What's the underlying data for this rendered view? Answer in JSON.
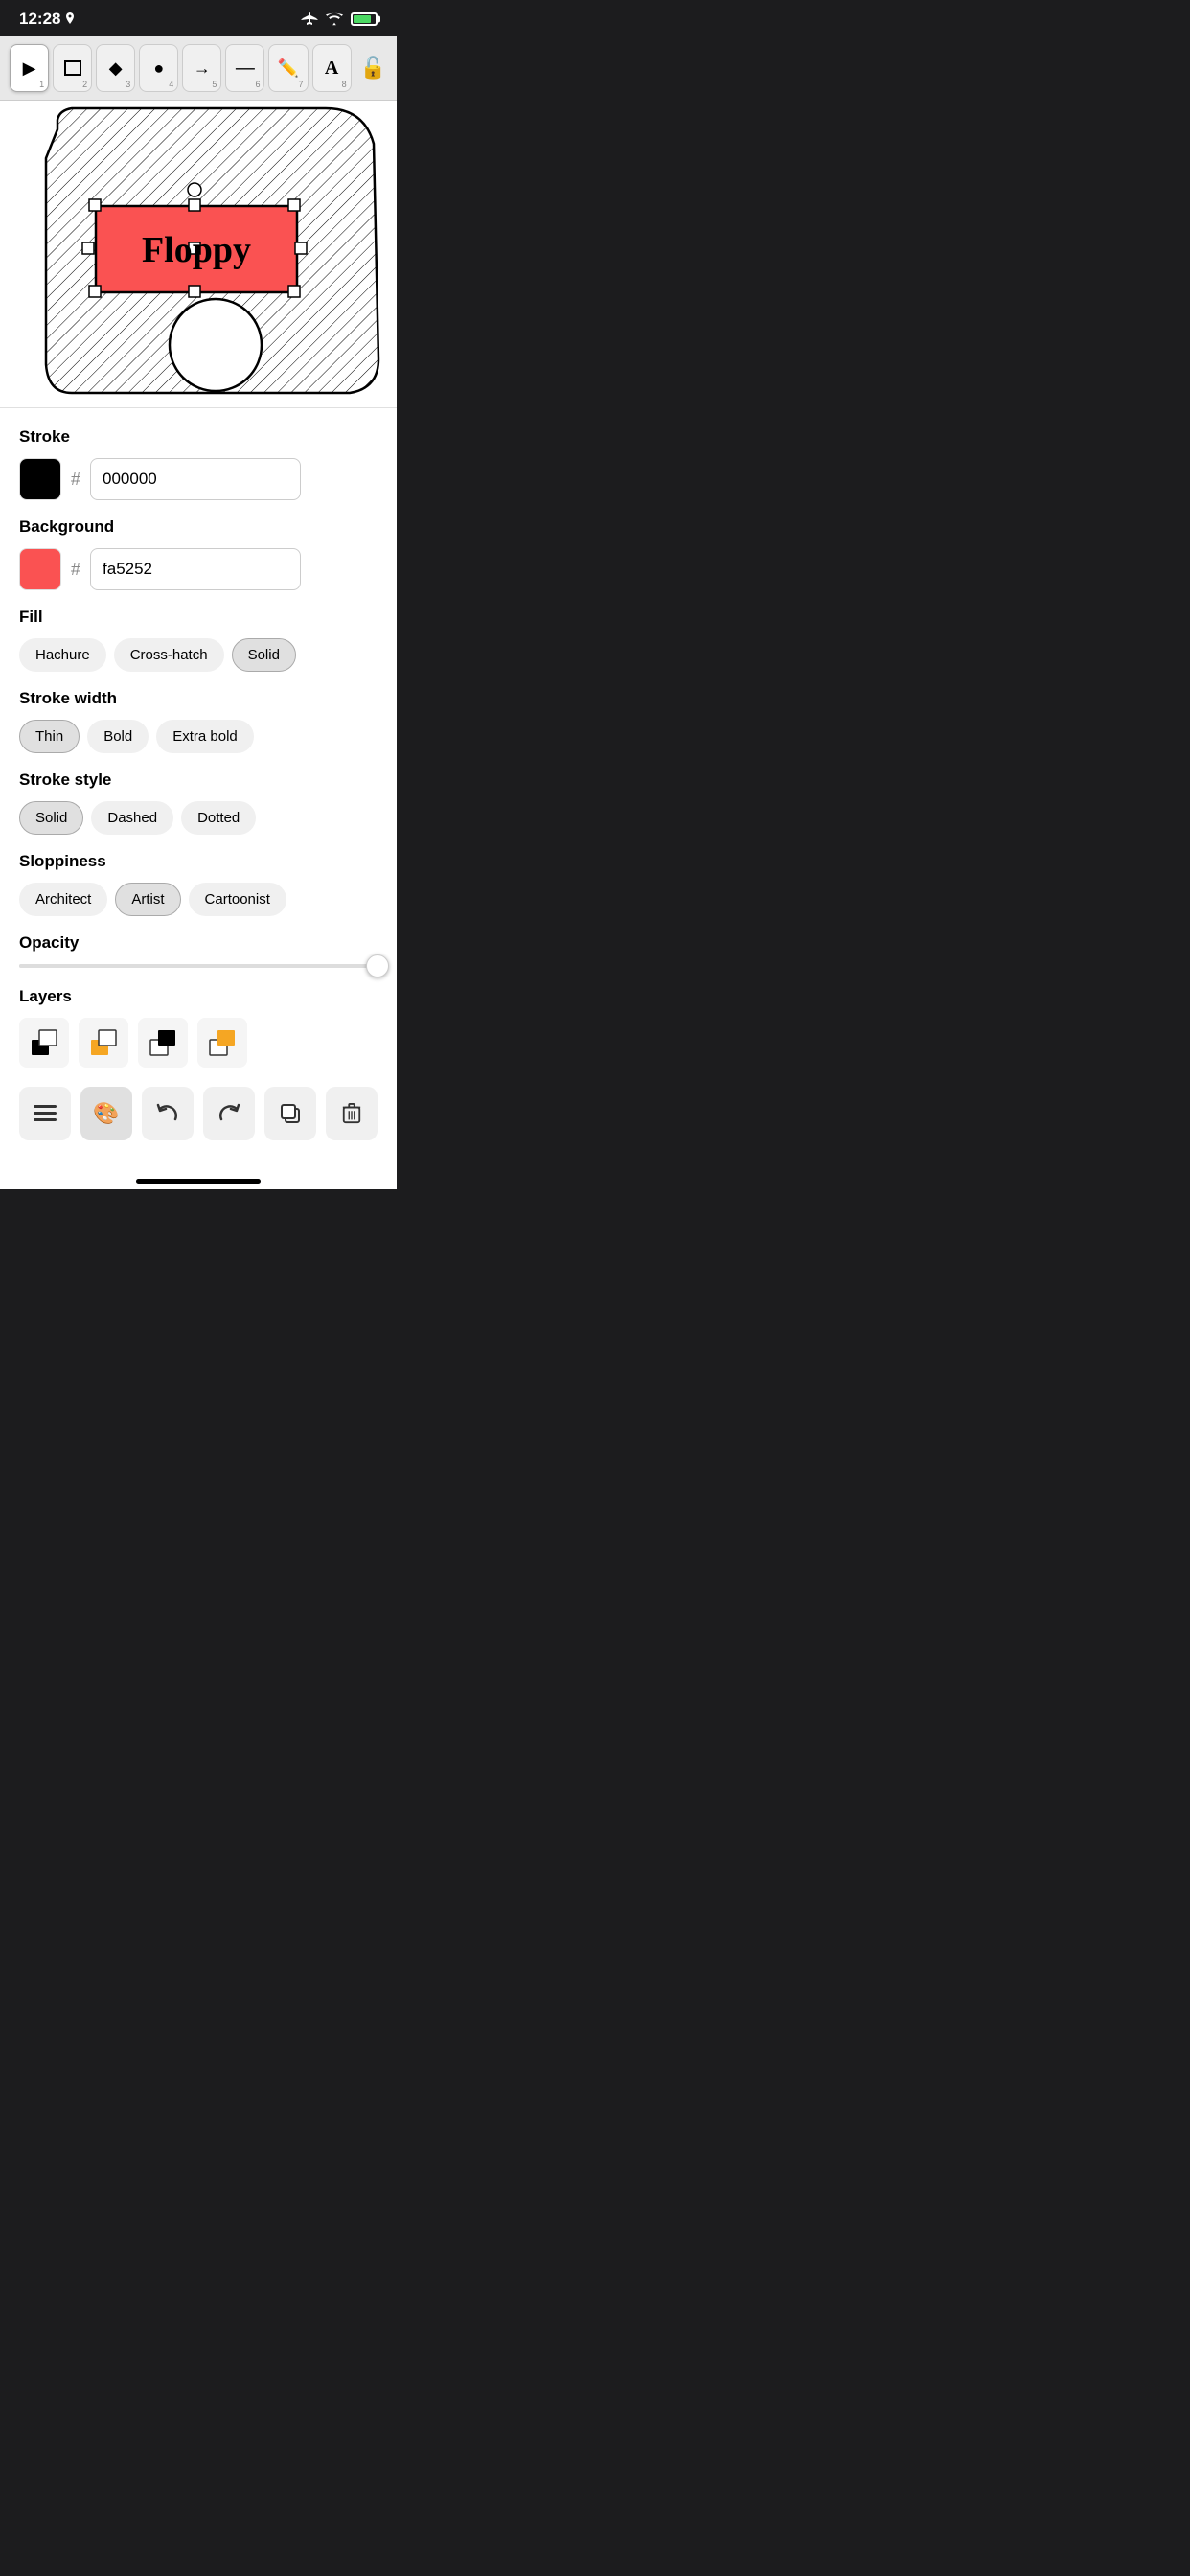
{
  "status": {
    "time": "12:28",
    "icons": [
      "location-icon",
      "airplane-icon",
      "wifi-icon",
      "battery-icon"
    ]
  },
  "toolbar": {
    "tools": [
      {
        "id": 1,
        "label": "cursor",
        "icon": "▶",
        "active": false
      },
      {
        "id": 2,
        "label": "rectangle",
        "icon": "■",
        "active": false
      },
      {
        "id": 3,
        "label": "diamond",
        "icon": "◆",
        "active": false
      },
      {
        "id": 4,
        "label": "circle",
        "icon": "●",
        "active": false
      },
      {
        "id": 5,
        "label": "arrow",
        "icon": "→",
        "active": false
      },
      {
        "id": 6,
        "label": "line",
        "icon": "—",
        "active": false
      },
      {
        "id": 7,
        "label": "pencil",
        "icon": "✏",
        "active": false
      },
      {
        "id": 8,
        "label": "text",
        "icon": "A",
        "active": false
      }
    ],
    "lock_icon": "🔓"
  },
  "canvas": {
    "description": "Floppy disk drawing with hatching pattern"
  },
  "properties": {
    "stroke_label": "Stroke",
    "stroke_color_hex": "000000",
    "stroke_swatch_color": "#000000",
    "background_label": "Background",
    "background_color_hex": "fa5252",
    "background_swatch_color": "#fa5252",
    "fill_label": "Fill",
    "fill_options": [
      {
        "label": "Hachure",
        "active": false
      },
      {
        "label": "Cross-hatch",
        "active": false
      },
      {
        "label": "Solid",
        "active": true
      }
    ],
    "stroke_width_label": "Stroke width",
    "stroke_width_options": [
      {
        "label": "Thin",
        "active": true
      },
      {
        "label": "Bold",
        "active": false
      },
      {
        "label": "Extra bold",
        "active": false
      }
    ],
    "stroke_style_label": "Stroke style",
    "stroke_style_options": [
      {
        "label": "Solid",
        "active": true
      },
      {
        "label": "Dashed",
        "active": false
      },
      {
        "label": "Dotted",
        "active": false
      }
    ],
    "sloppiness_label": "Sloppiness",
    "sloppiness_options": [
      {
        "label": "Architect",
        "active": false
      },
      {
        "label": "Artist",
        "active": true
      },
      {
        "label": "Cartoonist",
        "active": false
      }
    ],
    "opacity_label": "Opacity",
    "opacity_value": 100,
    "layers_label": "Layers"
  },
  "action_bar": {
    "buttons": [
      {
        "id": "menu",
        "icon": "≡",
        "active": false
      },
      {
        "id": "palette",
        "icon": "🎨",
        "active": true
      },
      {
        "id": "undo",
        "icon": "↩",
        "active": false
      },
      {
        "id": "redo",
        "icon": "↪",
        "active": false
      },
      {
        "id": "copy",
        "icon": "⧉",
        "active": false
      },
      {
        "id": "delete",
        "icon": "🗑",
        "active": false
      }
    ]
  }
}
